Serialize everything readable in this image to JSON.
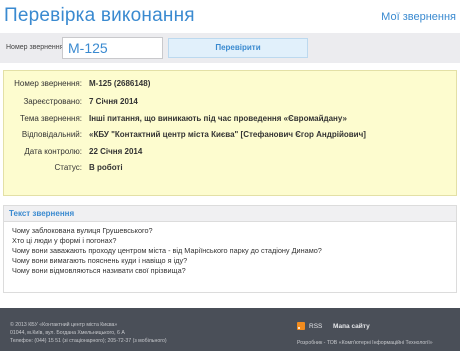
{
  "header": {
    "title": "Перевірка виконання",
    "my_requests_label": "Мої звернення"
  },
  "search": {
    "label": "Номер звернення:",
    "value": "M-125",
    "button_label": "Перевірити"
  },
  "details": {
    "rows": [
      {
        "label": "Номер звернення:",
        "value": "M-125 (2686148)"
      },
      {
        "label": "Зареєстровано:",
        "value": "7 Січня 2014"
      },
      {
        "label": "Тема звернення:",
        "value": "Інші питання, що виникають під час проведення «Євромайдану»"
      },
      {
        "label": "Відповідальний:",
        "value": "«КБУ \"Контактний центр міста Києва\" [Стефанович Єгор Андрійович]"
      },
      {
        "label": "Дата контролю:",
        "value": "22 Січня 2014"
      },
      {
        "label": "Статус:",
        "value": "В роботі"
      }
    ]
  },
  "request_text": {
    "title": "Текст звернення",
    "lines": [
      "Чому заблокована вулиця Грушевського?",
      "Хто ці люди у формі і погонах?",
      "Чому вони заважають проходу центром міста - від Маріїнського парку до стадіону Динамо?",
      "Чому вони вимагають пояснень куди і навіщо я іду?",
      "Чому вони відмовляються називати свої прізвища?"
    ]
  },
  "footer": {
    "copyright": "© 2013 КБУ «Контактний центр міста Києва»",
    "address": "01044, м.Київ, вул. Богдана Хмельницького, 6 А",
    "phone": "Телефон: (044) 15 51 (зі стаціонарного); 205-72-37 (з мобільного)",
    "rss_label": "RSS",
    "site_map_label": "Мапа сайту",
    "developer": "Розробник - ТОВ «Комп'ютерні Інформаційні Технології»"
  },
  "colors": {
    "accent": "#3a8ad0",
    "info_bg": "#fdfccf",
    "footer_bg": "#4a4f58",
    "rss": "#f28c1e"
  }
}
